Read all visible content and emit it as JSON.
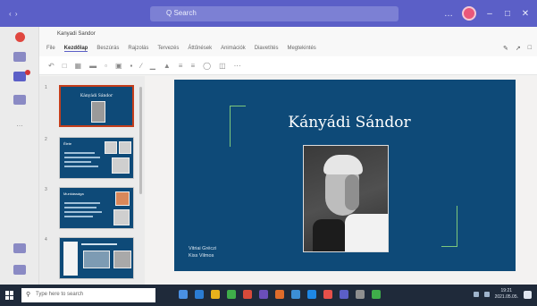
{
  "window": {
    "search_placeholder": "Q Search",
    "controls": [
      "…",
      "–",
      "□",
      "✕"
    ]
  },
  "file": {
    "name": "Kanyadi Sandor"
  },
  "menu": {
    "items": [
      "File",
      "Kezdőlap",
      "Beszúrás",
      "Rajzolás",
      "Tervezés",
      "Áttűnések",
      "Animációk",
      "Diavetítés",
      "Megtekintés"
    ],
    "active_index": 1
  },
  "slides": [
    {
      "number": "1",
      "title": "Kányádi Sándor"
    },
    {
      "number": "2",
      "title": "Élete"
    },
    {
      "number": "3",
      "title": "Munkássága"
    },
    {
      "number": "4",
      "title": ""
    }
  ],
  "current_slide": {
    "title": "Kányádi Sándor",
    "authors": [
      "Vitriai Gréczi",
      "Kiss Vilmos"
    ]
  },
  "taskbar": {
    "search_placeholder": "Type here to search",
    "app_colors": [
      "#4a90e2",
      "#2b7cd3",
      "#e8b21c",
      "#3fae4a",
      "#d84a3a",
      "#6b4fbb",
      "#e06c2a",
      "#3c8fd6",
      "#1e88e5",
      "#e5504a",
      "#5b5fc7",
      "#8f8f8f",
      "#3fae4a"
    ],
    "time": "19:21",
    "date": "2021.05.05."
  },
  "colors": {
    "teams_purple": "#5b5fc7",
    "slide_background": "#0e4a78",
    "accent_green": "#7dc87c",
    "selected_slide_border": "#c43e1c"
  }
}
